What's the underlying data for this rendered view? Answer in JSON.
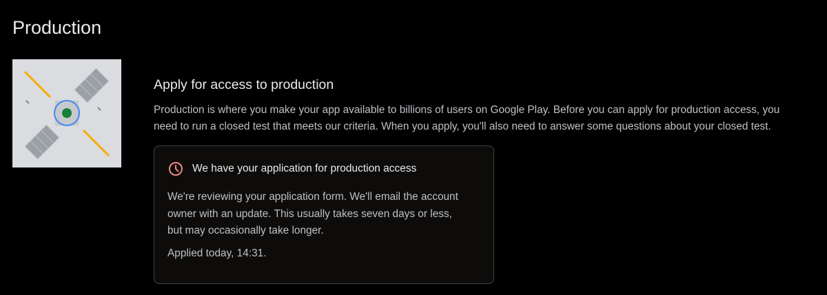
{
  "page": {
    "title": "Production"
  },
  "illustration": {
    "icon": "satellite-illustration",
    "colors": {
      "background": "#dadce0",
      "panel": "#9aa0a6",
      "beam": "#f9ab00",
      "ring": "#4285f4",
      "dot": "#188038"
    }
  },
  "section": {
    "heading": "Apply for access to production",
    "description_lines": [
      "Production is where you make your app available to billions of users on Google Play. Before you can apply for production access, you",
      "need to run a closed test that meets our criteria. When you apply, you'll also need to answer some questions about your closed test."
    ]
  },
  "status_card": {
    "icon": "clock-icon",
    "icon_color": "#f28b82",
    "title": "We have your application for production access",
    "body_lines": [
      "We're reviewing your application form. We'll email the account",
      "owner with an update. This usually takes seven days or less,",
      "but may occasionally take longer."
    ],
    "applied": "Applied today, 14:31."
  }
}
